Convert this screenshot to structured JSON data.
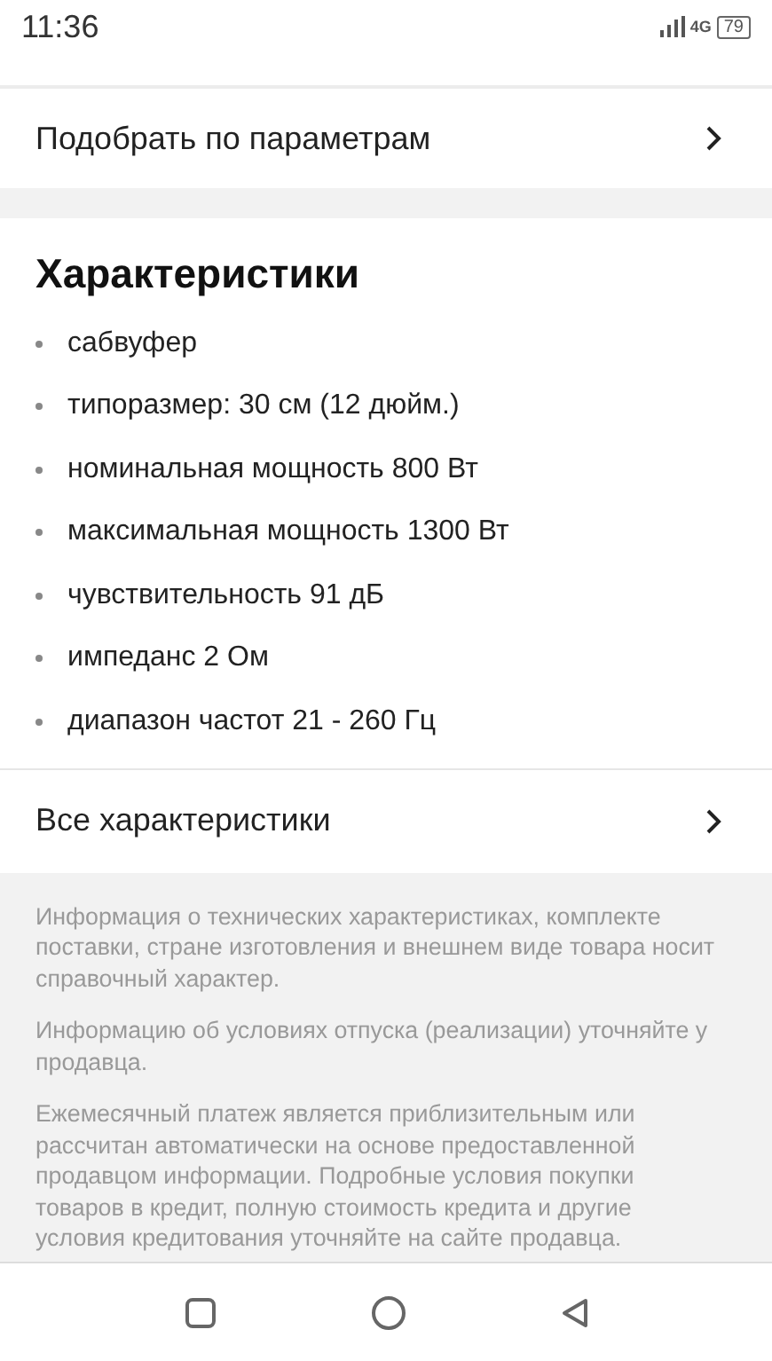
{
  "status_bar": {
    "time": "11:36",
    "network": "4G",
    "battery": "79"
  },
  "filter_row": {
    "label": "Подобрать по параметрам"
  },
  "specs": {
    "title": "Характеристики",
    "items": [
      "сабвуфер",
      "типоразмер: 30 см (12 дюйм.)",
      "номинальная мощность 800 Вт",
      "максимальная мощность 1300 Вт",
      "чувствительность 91 дБ",
      "импеданс 2 Ом",
      "диапазон частот 21 - 260 Гц"
    ]
  },
  "all_specs_row": {
    "label": "Все характеристики"
  },
  "disclaimers": [
    "Информация о технических характеристиках, комплекте поставки, стране изготовления и внешнем виде товара носит справочный характер.",
    "Информацию об условиях отпуска (реализации) уточняйте у продавца.",
    "Ежемесячный платеж является приблизительным или рассчитан автоматически на основе предоставленной продавцом информации. Подробные условия покупки товаров в кредит, полную стоимость кредита и другие условия кредитования уточняйте на сайте продавца."
  ]
}
